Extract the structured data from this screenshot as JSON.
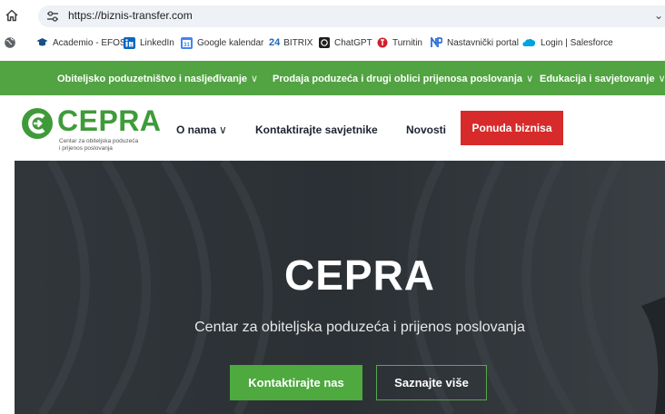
{
  "browser": {
    "url": "https://biznis-transfer.com",
    "overflow_glyph": "⌄",
    "icons": [
      "home-icon",
      "site-info-icon"
    ]
  },
  "bookmarks": [
    {
      "label": "Academio - EFOS",
      "icon": "graduation-cap-icon"
    },
    {
      "label": "LinkedIn",
      "icon": "linkedin-icon"
    },
    {
      "label": "Google kalendar",
      "icon": "google-calendar-icon"
    },
    {
      "label": "BITRIX",
      "icon": "bitrix24-icon",
      "prefix": "24"
    },
    {
      "label": "ChatGPT",
      "icon": "chatgpt-icon"
    },
    {
      "label": "Turnitin",
      "icon": "turnitin-icon"
    },
    {
      "label": "Nastavnički portal",
      "icon": "nastavnicki-portal-icon"
    },
    {
      "label": "Login | Salesforce",
      "icon": "salesforce-cloud-icon"
    }
  ],
  "green_nav": [
    {
      "label": "Obiteljsko poduzetništvo i nasljeđivanje",
      "chevron": "∨"
    },
    {
      "label": "Prodaja poduzeća i drugi oblici prijenosa poslovanja",
      "chevron": "∨"
    },
    {
      "label": "Edukacija i savjetovanje",
      "chevron": "∨"
    }
  ],
  "header": {
    "logo_word": "CEPRA",
    "logo_tagline_1": "Centar za obiteljska poduzeća",
    "logo_tagline_2": "i prijenos poslovanja",
    "menu": [
      {
        "label": "O nama",
        "chevron": "∨"
      },
      {
        "label": "Kontaktirajte savjetnike"
      },
      {
        "label": "Novosti"
      }
    ],
    "cta_label": "Ponuda biznisa"
  },
  "hero": {
    "title": "CEPRA",
    "subtitle": "Centar za obiteljska poduzeća i prijenos poslovanja",
    "primary_button": "Kontaktirajte nas",
    "secondary_button": "Saznajte više"
  },
  "colors": {
    "brand_green": "#52a342",
    "logo_green": "#3f9b3a",
    "cta_red": "#d72b2b",
    "hero_bg": "#2e3338"
  }
}
